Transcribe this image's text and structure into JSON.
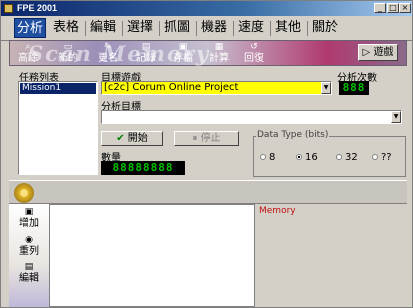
{
  "window": {
    "title": "FPE 2001",
    "min": "_",
    "max": "□",
    "close": "×"
  },
  "tabs": [
    "分析",
    "表格",
    "編輯",
    "選擇",
    "抓圖",
    "機器",
    "速度",
    "其他",
    "關於"
  ],
  "toolbar": {
    "watermark": "Scan Memory",
    "buttons": [
      {
        "label": "高除",
        "icon": "scan-icon",
        "glyph": "⌕"
      },
      {
        "label": "新的",
        "icon": "new-icon",
        "glyph": "▭"
      },
      {
        "label": "更名",
        "icon": "rename-icon",
        "glyph": "✎"
      },
      {
        "label": "記錄",
        "icon": "record-icon",
        "glyph": "▤"
      },
      {
        "label": "存檔",
        "icon": "save-icon",
        "glyph": "▣"
      },
      {
        "label": "計算",
        "icon": "calc-icon",
        "glyph": "▦"
      },
      {
        "label": "回復",
        "icon": "undo-icon",
        "glyph": "↺"
      }
    ],
    "game_label": "遊戲",
    "game_glyph": "▷"
  },
  "tasks": {
    "label": "任務列表",
    "items": [
      "Mission1"
    ]
  },
  "target_game": {
    "label": "目標遊戲",
    "value": "[c2c] Corum Online Project"
  },
  "analyze_count": {
    "label": "分析次數",
    "value": "888"
  },
  "analyze_target": {
    "label": "分析目標",
    "value": ""
  },
  "buttons": {
    "start": "開始",
    "stop": "停止",
    "start_glyph": "✔",
    "stop_glyph": "⏸"
  },
  "quantity": {
    "label": "數量",
    "value": "88888888"
  },
  "datatype": {
    "title": "Data Type (bits)",
    "options": [
      "8",
      "16",
      "32",
      "??"
    ],
    "selected": "16"
  },
  "sidebar": [
    {
      "label": "增加",
      "icon": "add-icon",
      "glyph": "▣"
    },
    {
      "label": "重列",
      "icon": "relist-icon",
      "glyph": "◉"
    },
    {
      "label": "編輯",
      "icon": "edit-icon",
      "glyph": "▤"
    }
  ],
  "memory": {
    "title": "Memory"
  }
}
